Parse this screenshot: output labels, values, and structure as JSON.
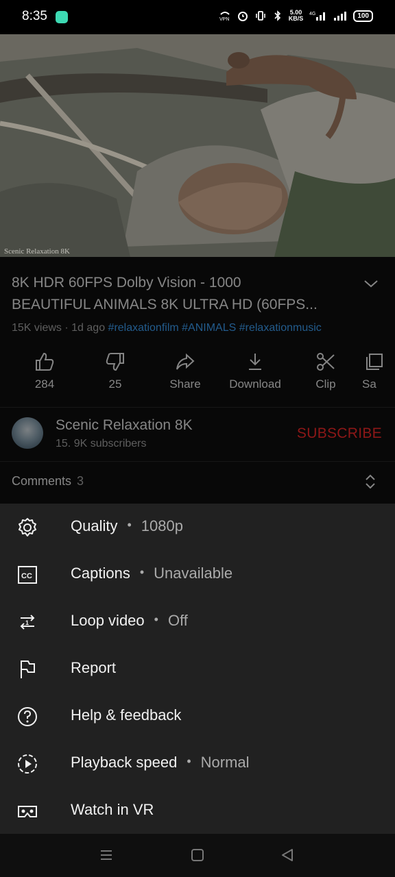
{
  "status_bar": {
    "time": "8:35",
    "network_speed": "5.00",
    "network_speed_unit": "KB/S",
    "battery": "100"
  },
  "video": {
    "watermark": "Scenic Relaxation 8K"
  },
  "details": {
    "title_line1": "8K HDR 60FPS Dolby Vision - 1000",
    "title_line2": "BEAUTIFUL ANIMALS 8K ULTRA HD (60FPS...",
    "views": "15K views",
    "age": "1d ago",
    "hashtags": "#relaxationfilm #ANIMALS #relaxationmusic"
  },
  "actions": {
    "like": "284",
    "dislike": "25",
    "share": "Share",
    "download": "Download",
    "clip": "Clip",
    "save": "Sa"
  },
  "channel": {
    "name": "Scenic Relaxation 8K",
    "subscribers": "15. 9K subscribers",
    "subscribe": "SUBSCRIBE"
  },
  "comments": {
    "label": "Comments",
    "count": "3"
  },
  "menu": {
    "quality_label": "Quality",
    "quality_value": "1080p",
    "captions_label": "Captions",
    "captions_value": "Unavailable",
    "loop_label": "Loop video",
    "loop_value": "Off",
    "report_label": "Report",
    "help_label": "Help & feedback",
    "speed_label": "Playback speed",
    "speed_value": "Normal",
    "vr_label": "Watch in VR",
    "separator": "•"
  },
  "colors": {
    "sheet_bg": "#212121",
    "subscribe": "#ff2a2a",
    "hashtag": "#3ea6ff"
  }
}
